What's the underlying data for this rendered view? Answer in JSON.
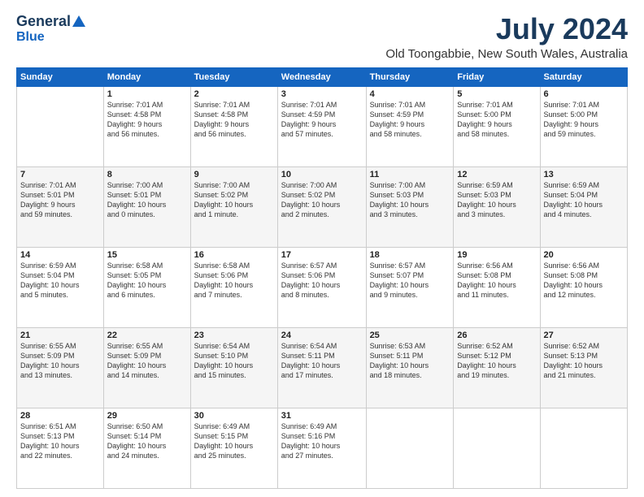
{
  "logo": {
    "general": "General",
    "blue": "Blue"
  },
  "header": {
    "month_title": "July 2024",
    "location": "Old Toongabbie, New South Wales, Australia"
  },
  "weekdays": [
    "Sunday",
    "Monday",
    "Tuesday",
    "Wednesday",
    "Thursday",
    "Friday",
    "Saturday"
  ],
  "weeks": [
    [
      {
        "date": "",
        "info": []
      },
      {
        "date": "1",
        "info": [
          "Sunrise: 7:01 AM",
          "Sunset: 4:58 PM",
          "Daylight: 9 hours",
          "and 56 minutes."
        ]
      },
      {
        "date": "2",
        "info": [
          "Sunrise: 7:01 AM",
          "Sunset: 4:58 PM",
          "Daylight: 9 hours",
          "and 56 minutes."
        ]
      },
      {
        "date": "3",
        "info": [
          "Sunrise: 7:01 AM",
          "Sunset: 4:59 PM",
          "Daylight: 9 hours",
          "and 57 minutes."
        ]
      },
      {
        "date": "4",
        "info": [
          "Sunrise: 7:01 AM",
          "Sunset: 4:59 PM",
          "Daylight: 9 hours",
          "and 58 minutes."
        ]
      },
      {
        "date": "5",
        "info": [
          "Sunrise: 7:01 AM",
          "Sunset: 5:00 PM",
          "Daylight: 9 hours",
          "and 58 minutes."
        ]
      },
      {
        "date": "6",
        "info": [
          "Sunrise: 7:01 AM",
          "Sunset: 5:00 PM",
          "Daylight: 9 hours",
          "and 59 minutes."
        ]
      }
    ],
    [
      {
        "date": "7",
        "info": [
          "Sunrise: 7:01 AM",
          "Sunset: 5:01 PM",
          "Daylight: 9 hours",
          "and 59 minutes."
        ]
      },
      {
        "date": "8",
        "info": [
          "Sunrise: 7:00 AM",
          "Sunset: 5:01 PM",
          "Daylight: 10 hours",
          "and 0 minutes."
        ]
      },
      {
        "date": "9",
        "info": [
          "Sunrise: 7:00 AM",
          "Sunset: 5:02 PM",
          "Daylight: 10 hours",
          "and 1 minute."
        ]
      },
      {
        "date": "10",
        "info": [
          "Sunrise: 7:00 AM",
          "Sunset: 5:02 PM",
          "Daylight: 10 hours",
          "and 2 minutes."
        ]
      },
      {
        "date": "11",
        "info": [
          "Sunrise: 7:00 AM",
          "Sunset: 5:03 PM",
          "Daylight: 10 hours",
          "and 3 minutes."
        ]
      },
      {
        "date": "12",
        "info": [
          "Sunrise: 6:59 AM",
          "Sunset: 5:03 PM",
          "Daylight: 10 hours",
          "and 3 minutes."
        ]
      },
      {
        "date": "13",
        "info": [
          "Sunrise: 6:59 AM",
          "Sunset: 5:04 PM",
          "Daylight: 10 hours",
          "and 4 minutes."
        ]
      }
    ],
    [
      {
        "date": "14",
        "info": [
          "Sunrise: 6:59 AM",
          "Sunset: 5:04 PM",
          "Daylight: 10 hours",
          "and 5 minutes."
        ]
      },
      {
        "date": "15",
        "info": [
          "Sunrise: 6:58 AM",
          "Sunset: 5:05 PM",
          "Daylight: 10 hours",
          "and 6 minutes."
        ]
      },
      {
        "date": "16",
        "info": [
          "Sunrise: 6:58 AM",
          "Sunset: 5:06 PM",
          "Daylight: 10 hours",
          "and 7 minutes."
        ]
      },
      {
        "date": "17",
        "info": [
          "Sunrise: 6:57 AM",
          "Sunset: 5:06 PM",
          "Daylight: 10 hours",
          "and 8 minutes."
        ]
      },
      {
        "date": "18",
        "info": [
          "Sunrise: 6:57 AM",
          "Sunset: 5:07 PM",
          "Daylight: 10 hours",
          "and 9 minutes."
        ]
      },
      {
        "date": "19",
        "info": [
          "Sunrise: 6:56 AM",
          "Sunset: 5:08 PM",
          "Daylight: 10 hours",
          "and 11 minutes."
        ]
      },
      {
        "date": "20",
        "info": [
          "Sunrise: 6:56 AM",
          "Sunset: 5:08 PM",
          "Daylight: 10 hours",
          "and 12 minutes."
        ]
      }
    ],
    [
      {
        "date": "21",
        "info": [
          "Sunrise: 6:55 AM",
          "Sunset: 5:09 PM",
          "Daylight: 10 hours",
          "and 13 minutes."
        ]
      },
      {
        "date": "22",
        "info": [
          "Sunrise: 6:55 AM",
          "Sunset: 5:09 PM",
          "Daylight: 10 hours",
          "and 14 minutes."
        ]
      },
      {
        "date": "23",
        "info": [
          "Sunrise: 6:54 AM",
          "Sunset: 5:10 PM",
          "Daylight: 10 hours",
          "and 15 minutes."
        ]
      },
      {
        "date": "24",
        "info": [
          "Sunrise: 6:54 AM",
          "Sunset: 5:11 PM",
          "Daylight: 10 hours",
          "and 17 minutes."
        ]
      },
      {
        "date": "25",
        "info": [
          "Sunrise: 6:53 AM",
          "Sunset: 5:11 PM",
          "Daylight: 10 hours",
          "and 18 minutes."
        ]
      },
      {
        "date": "26",
        "info": [
          "Sunrise: 6:52 AM",
          "Sunset: 5:12 PM",
          "Daylight: 10 hours",
          "and 19 minutes."
        ]
      },
      {
        "date": "27",
        "info": [
          "Sunrise: 6:52 AM",
          "Sunset: 5:13 PM",
          "Daylight: 10 hours",
          "and 21 minutes."
        ]
      }
    ],
    [
      {
        "date": "28",
        "info": [
          "Sunrise: 6:51 AM",
          "Sunset: 5:13 PM",
          "Daylight: 10 hours",
          "and 22 minutes."
        ]
      },
      {
        "date": "29",
        "info": [
          "Sunrise: 6:50 AM",
          "Sunset: 5:14 PM",
          "Daylight: 10 hours",
          "and 24 minutes."
        ]
      },
      {
        "date": "30",
        "info": [
          "Sunrise: 6:49 AM",
          "Sunset: 5:15 PM",
          "Daylight: 10 hours",
          "and 25 minutes."
        ]
      },
      {
        "date": "31",
        "info": [
          "Sunrise: 6:49 AM",
          "Sunset: 5:16 PM",
          "Daylight: 10 hours",
          "and 27 minutes."
        ]
      },
      {
        "date": "",
        "info": []
      },
      {
        "date": "",
        "info": []
      },
      {
        "date": "",
        "info": []
      }
    ]
  ]
}
